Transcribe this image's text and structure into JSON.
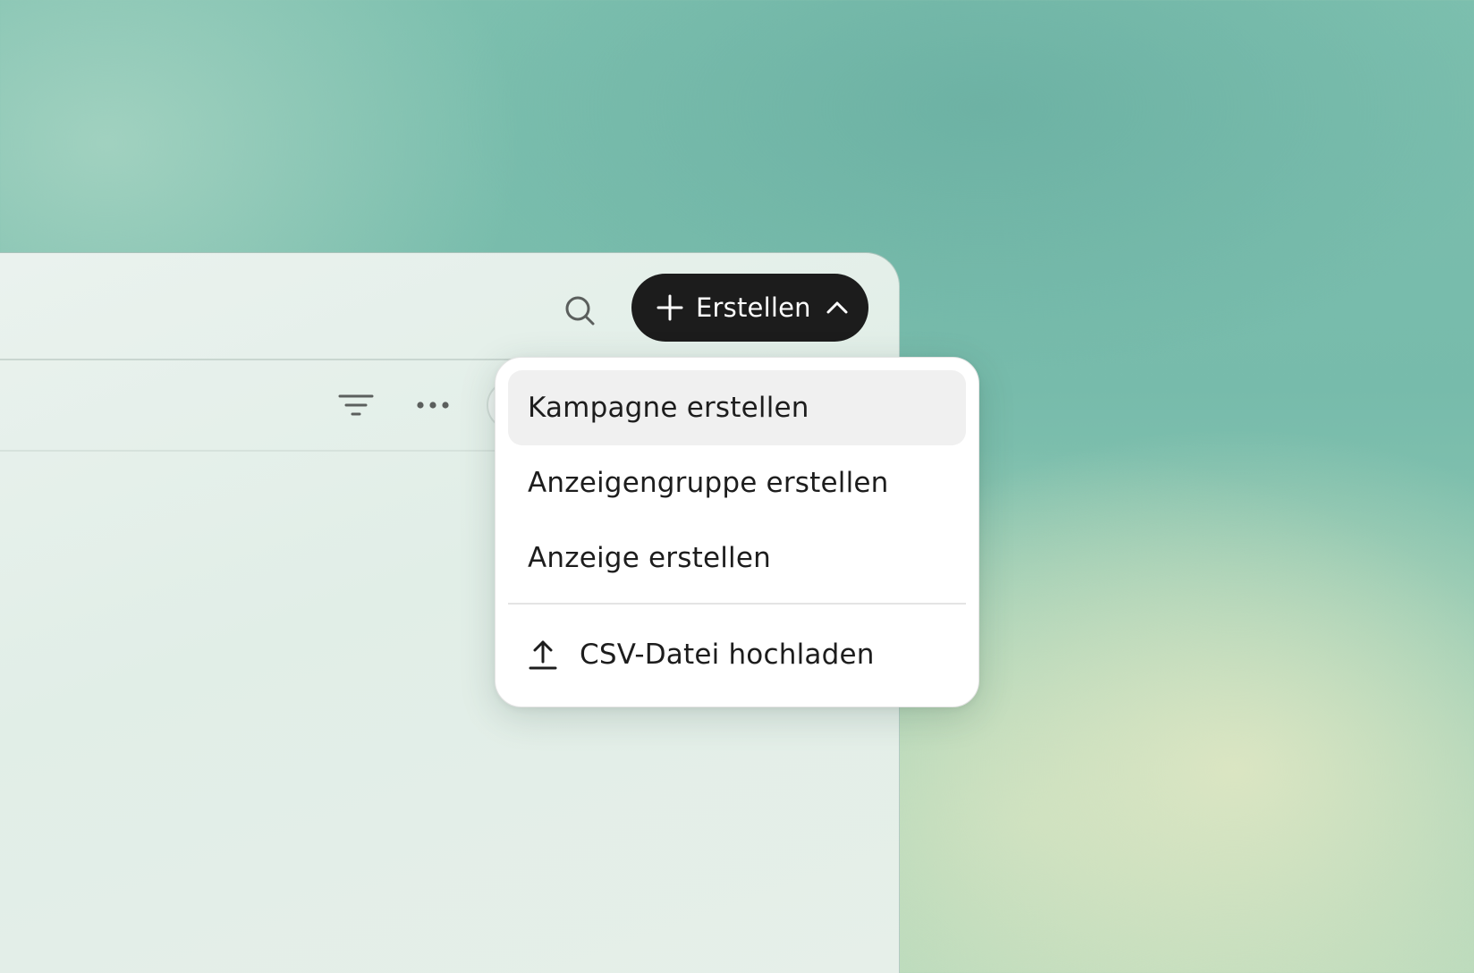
{
  "header": {
    "create_button_label": "Erstellen"
  },
  "icons": {
    "search": "search-icon",
    "plus": "plus-icon",
    "chevron": "chevron-up-icon",
    "filter": "filter-icon",
    "more": "more-horizontal-icon",
    "upload": "upload-icon"
  },
  "dropdown": {
    "items": [
      {
        "label": "Kampagne erstellen",
        "highlighted": true
      },
      {
        "label": "Anzeigengruppe erstellen",
        "highlighted": false
      },
      {
        "label": "Anzeige erstellen",
        "highlighted": false
      }
    ],
    "upload_label": "CSV-Datei hochladen"
  },
  "colors": {
    "button_bg": "#1c1c1c",
    "menu_bg": "#ffffff",
    "highlight_bg": "#f0f0f0"
  }
}
